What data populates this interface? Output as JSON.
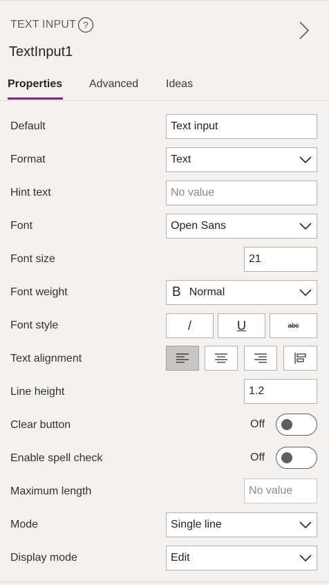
{
  "header": {
    "control_type": "TEXT INPUT",
    "control_name": "TextInput1"
  },
  "tabs": [
    {
      "label": "Properties",
      "active": true
    },
    {
      "label": "Advanced",
      "active": false
    },
    {
      "label": "Ideas",
      "active": false
    }
  ],
  "properties": {
    "default": {
      "label": "Default",
      "value": "Text input"
    },
    "format": {
      "label": "Format",
      "value": "Text"
    },
    "hint_text": {
      "label": "Hint text",
      "placeholder": "No value"
    },
    "font": {
      "label": "Font",
      "value": "Open Sans"
    },
    "font_size": {
      "label": "Font size",
      "value": "21"
    },
    "font_weight": {
      "label": "Font weight",
      "glyph": "B",
      "value": "Normal"
    },
    "font_style": {
      "label": "Font style",
      "italic": "/",
      "underline": "U",
      "strikethrough": "abc"
    },
    "text_alignment": {
      "label": "Text alignment",
      "selected": "left"
    },
    "line_height": {
      "label": "Line height",
      "value": "1.2"
    },
    "clear_button": {
      "label": "Clear button",
      "state": "Off"
    },
    "spell_check": {
      "label": "Enable spell check",
      "state": "Off"
    },
    "max_length": {
      "label": "Maximum length",
      "placeholder": "No value"
    },
    "mode": {
      "label": "Mode",
      "value": "Single line"
    },
    "display_mode": {
      "label": "Display mode",
      "value": "Edit"
    }
  },
  "colors": {
    "accent": "#742774",
    "panel_bg": "#f3f2f1",
    "selected_bg": "#c8c6c4"
  },
  "icons": {
    "help": "help-circle-icon",
    "expand": "chevron-right-icon",
    "dropdown": "chevron-down-icon"
  }
}
